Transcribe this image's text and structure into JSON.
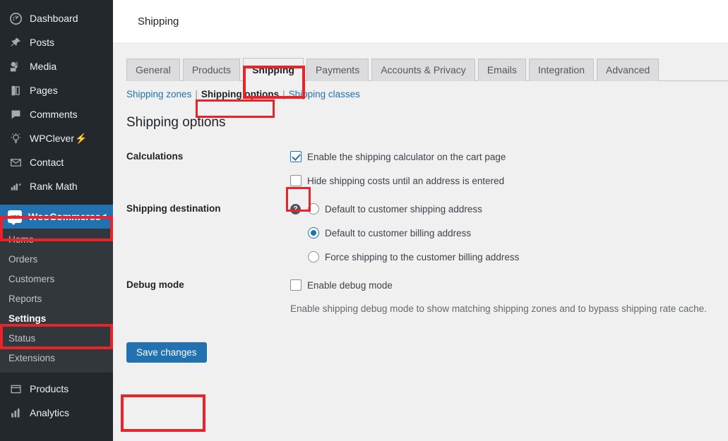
{
  "sidebar": {
    "items": [
      {
        "label": "Dashboard",
        "icon": "dashboard-icon"
      },
      {
        "label": "Posts",
        "icon": "pin-icon"
      },
      {
        "label": "Media",
        "icon": "media-icon"
      },
      {
        "label": "Pages",
        "icon": "pages-icon"
      },
      {
        "label": "Comments",
        "icon": "comment-icon"
      },
      {
        "label": "WPClever",
        "icon": "lightbulb-icon",
        "suffix": "⚡"
      },
      {
        "label": "Contact",
        "icon": "envelope-icon"
      },
      {
        "label": "Rank Math",
        "icon": "rankmath-icon"
      }
    ],
    "woocommerce": {
      "label": "WooCommerce",
      "badge_text": "woo",
      "arrow": "◄",
      "submenu": [
        {
          "label": "Home",
          "current": false
        },
        {
          "label": "Orders",
          "current": false
        },
        {
          "label": "Customers",
          "current": false
        },
        {
          "label": "Reports",
          "current": false
        },
        {
          "label": "Settings",
          "current": true
        },
        {
          "label": "Status",
          "current": false
        },
        {
          "label": "Extensions",
          "current": false
        }
      ]
    },
    "bottom_items": [
      {
        "label": "Products",
        "icon": "products-icon"
      },
      {
        "label": "Analytics",
        "icon": "analytics-icon"
      }
    ]
  },
  "topbar": {
    "title": "Shipping"
  },
  "tabs": [
    {
      "label": "General",
      "active": false
    },
    {
      "label": "Products",
      "active": false
    },
    {
      "label": "Shipping",
      "active": true
    },
    {
      "label": "Payments",
      "active": false
    },
    {
      "label": "Accounts & Privacy",
      "active": false
    },
    {
      "label": "Emails",
      "active": false
    },
    {
      "label": "Integration",
      "active": false
    },
    {
      "label": "Advanced",
      "active": false
    }
  ],
  "subnav": {
    "items": [
      {
        "label": "Shipping zones",
        "current": false
      },
      {
        "label": "Shipping options",
        "current": true
      },
      {
        "label": "Shipping classes",
        "current": false
      }
    ],
    "separator": "|"
  },
  "page": {
    "section_title": "Shipping options",
    "rows": {
      "calculations": {
        "label": "Calculations",
        "options": [
          {
            "label": "Enable the shipping calculator on the cart page",
            "checked": true
          },
          {
            "label": "Hide shipping costs until an address is entered",
            "checked": false
          }
        ]
      },
      "shipping_destination": {
        "label": "Shipping destination",
        "help_glyph": "?",
        "options": [
          {
            "label": "Default to customer shipping address",
            "selected": false
          },
          {
            "label": "Default to customer billing address",
            "selected": true
          },
          {
            "label": "Force shipping to the customer billing address",
            "selected": false
          }
        ]
      },
      "debug_mode": {
        "label": "Debug mode",
        "option": {
          "label": "Enable debug mode",
          "checked": false
        },
        "description": "Enable shipping debug mode to show matching shipping zones and to bypass shipping rate cache."
      }
    },
    "save_label": "Save changes"
  },
  "colors": {
    "accent": "#2271b1",
    "sidebar_bg": "#23282d",
    "submenu_bg": "#32373c",
    "content_bg": "#f0f0f1",
    "annotation": "#e8242a",
    "bolt": "#f5a623"
  }
}
